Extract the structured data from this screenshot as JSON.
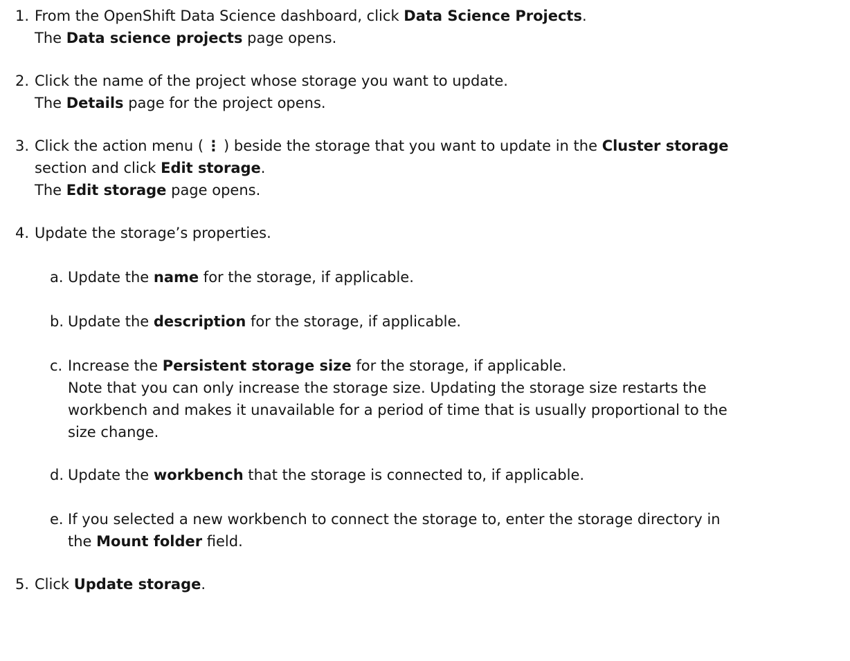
{
  "steps": [
    {
      "number": "1.",
      "text1": "From the OpenShift Data Science dashboard, click ",
      "bold1": "Data Science Projects",
      "text2": ".",
      "result_pre": "The ",
      "result_bold": "Data science projects",
      "result_post": " page opens."
    },
    {
      "number": "2.",
      "text1": "Click the name of the project whose storage you want to update.",
      "result_pre": "The ",
      "result_bold": "Details",
      "result_post": " page for the project opens."
    },
    {
      "number": "3.",
      "text1": "Click the action menu (",
      "kebab": "⋮",
      "text2": ") beside the storage that you want to update in the ",
      "bold1": "Cluster storage",
      "text3": "section and click ",
      "bold2": "Edit storage",
      "text4": ".",
      "result_pre": "The ",
      "result_bold": "Edit storage",
      "result_post": " page opens."
    },
    {
      "number": "4.",
      "text1": "Update the storage’s properties."
    },
    {
      "number": "5.",
      "text1": "Click ",
      "bold1": "Update storage",
      "text2": "."
    }
  ],
  "substeps": [
    {
      "letter": "a.",
      "text1": "Update the ",
      "bold1": "name",
      "text2": " for the storage, if applicable."
    },
    {
      "letter": "b.",
      "text1": "Update the ",
      "bold1": "description",
      "text2": " for the storage, if applicable."
    },
    {
      "letter": "c.",
      "text1": "Increase the ",
      "bold1": "Persistent storage size",
      "text2": " for the storage, if applicable.",
      "note1": "Note that you can only increase the storage size. Updating the storage size restarts the",
      "note2": "workbench and makes it unavailable for a period of time that is usually proportional to the",
      "note3": "size change."
    },
    {
      "letter": "d.",
      "text1": "Update the ",
      "bold1": "workbench",
      "text2": " that the storage is connected to, if applicable."
    },
    {
      "letter": "e.",
      "text1": "If you selected a new workbench to connect the storage to, enter the storage directory in",
      "text2": "the ",
      "bold1": "Mount folder",
      "text3": " field."
    }
  ]
}
